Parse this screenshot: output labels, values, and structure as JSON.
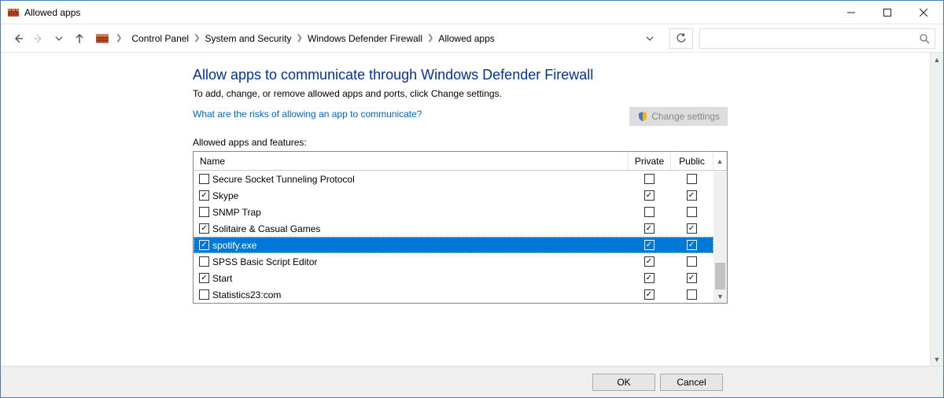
{
  "window": {
    "title": "Allowed apps"
  },
  "breadcrumb": {
    "items": [
      "Control Panel",
      "System and Security",
      "Windows Defender Firewall",
      "Allowed apps"
    ]
  },
  "search": {
    "placeholder": ""
  },
  "page": {
    "heading": "Allow apps to communicate through Windows Defender Firewall",
    "subtext": "To add, change, or remove allowed apps and ports, click Change settings.",
    "risk_link": "What are the risks of allowing an app to communicate?",
    "change_settings": "Change settings",
    "listlabel": "Allowed apps and features:",
    "columns": {
      "name": "Name",
      "private": "Private",
      "public": "Public"
    },
    "rows": [
      {
        "enabled": false,
        "name": "Secure Socket Tunneling Protocol",
        "private": false,
        "public": false,
        "selected": false
      },
      {
        "enabled": true,
        "name": "Skype",
        "private": true,
        "public": true,
        "selected": false
      },
      {
        "enabled": false,
        "name": "SNMP Trap",
        "private": false,
        "public": false,
        "selected": false
      },
      {
        "enabled": true,
        "name": "Solitaire & Casual Games",
        "private": true,
        "public": true,
        "selected": false
      },
      {
        "enabled": true,
        "name": "spotify.exe",
        "private": true,
        "public": true,
        "selected": true
      },
      {
        "enabled": false,
        "name": "SPSS Basic Script Editor",
        "private": true,
        "public": false,
        "selected": false
      },
      {
        "enabled": true,
        "name": "Start",
        "private": true,
        "public": true,
        "selected": false
      },
      {
        "enabled": false,
        "name": "Statistics23:com",
        "private": true,
        "public": false,
        "selected": false
      }
    ]
  },
  "footer": {
    "ok": "OK",
    "cancel": "Cancel"
  }
}
